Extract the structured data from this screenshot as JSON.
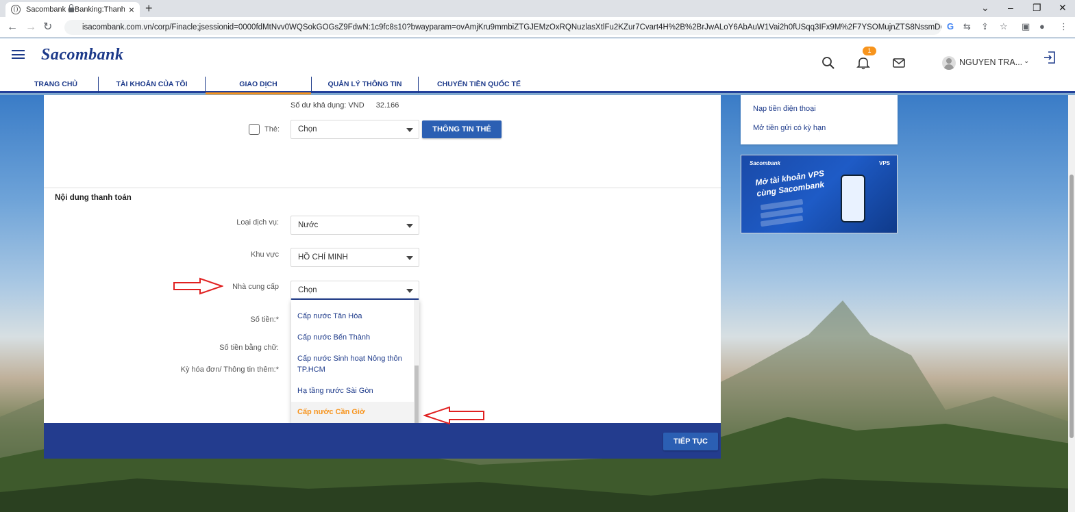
{
  "browser": {
    "tab_title": "Sacombank e-Banking:Thanh toá",
    "tab_close": "×",
    "new_tab": "+",
    "url": "isacombank.com.vn/corp/Finacle;jsessionid=0000fdMtNvv0WQSokGOGsZ9FdwN:1c9fc8s10?bwayparam=ovAmjKru9mmbiZTGJEMzOxRQNuzlasXtlFu2KZur7Cvart4H%2B%2BrJwALoY6AbAuW1Vai2h0fUSqq3IFx9M%2F7YSOMujnZTS8NssmD6Yt5Riz4j...",
    "win_controls": [
      "⌄",
      "–",
      "❐",
      "✕"
    ]
  },
  "header": {
    "logo": "Sacombank",
    "notification_count": "1",
    "user_name": "NGUYEN TRA...",
    "menu": [
      {
        "label": "TRANG CHỦ",
        "active": false
      },
      {
        "label": "TÀI KHOẢN CỦA TÔI",
        "active": false
      },
      {
        "label": "GIAO DỊCH",
        "active": true
      },
      {
        "label": "QUẢN LÝ THÔNG TIN",
        "active": false
      },
      {
        "label": "CHUYỂN TIỀN QUỐC TẾ",
        "active": false
      }
    ]
  },
  "form": {
    "balance_label": "Số dư khả dụng: VND",
    "balance_value": "32.166",
    "card_label": "Thẻ:",
    "card_select": "Chọn",
    "card_info_button": "THÔNG TIN THẺ",
    "section_title": "Nội dung thanh toán",
    "service_type_label": "Loại dịch vụ:",
    "service_type_value": "Nước",
    "region_label": "Khu vực",
    "region_value": "HỒ CHÍ MINH",
    "provider_label": "Nhà cung cấp",
    "provider_value": "Chọn",
    "amount_label": "Số tiền:*",
    "amount_words_label": "Số tiền bằng chữ:",
    "bill_period_label": "Kỳ hóa đơn/ Thông tin thêm:*",
    "provider_options": [
      "Cấp nước Tân Hòa",
      "Cấp nước Bến Thành",
      "Cấp nước Sinh hoạt Nông thôn TP.HCM",
      "Hạ tầng nước Sài Gòn",
      "Cấp nước Cần Giờ"
    ],
    "highlighted_option": "Cấp nước Cần Giờ",
    "continue_button": "TIẾP TỤC"
  },
  "sidebar": {
    "links": [
      "Nạp tiền điện thoại",
      "Mở tiền gửi có kỳ hạn"
    ],
    "banner": {
      "brand": "Sacombank",
      "partner": "VPS",
      "line1": "Mở tài khoản VPS",
      "line2": "cùng Sacombank"
    }
  },
  "colors": {
    "brand_blue": "#1d3a8a",
    "accent_orange": "#f7941d",
    "button_blue": "#2b5fb3",
    "footer_blue": "#233c8e",
    "annotation_red": "#e02020"
  }
}
